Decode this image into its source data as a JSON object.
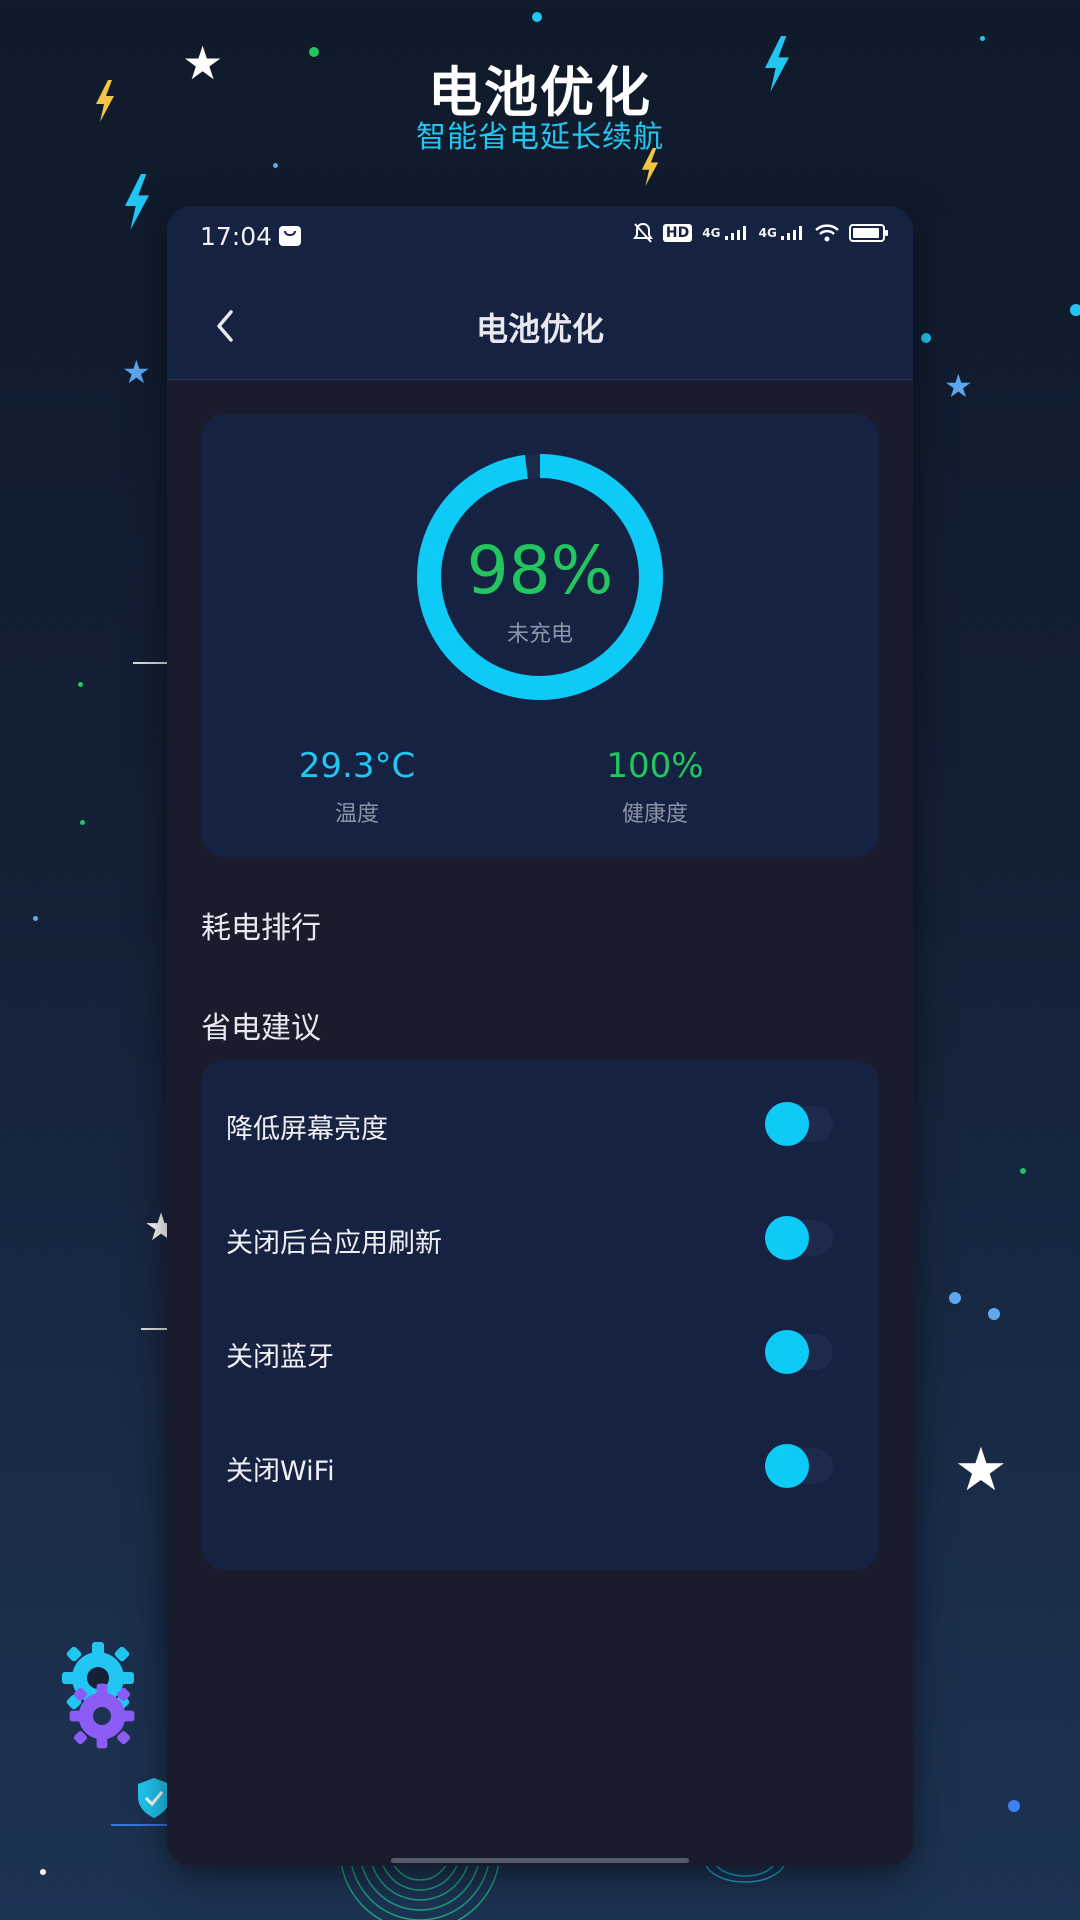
{
  "poster": {
    "title": "电池优化",
    "subtitle": "智能省电延长续航"
  },
  "status_bar": {
    "time": "17:04",
    "icons": [
      "message-icon",
      "mute-icon",
      "hd-icon",
      "signal-4g-icon",
      "signal-4g-icon",
      "wifi-icon",
      "battery-icon"
    ],
    "hd_label": "HD",
    "network_labels": [
      "4G",
      "4G"
    ]
  },
  "header": {
    "title": "电池优化",
    "back_icon": "chevron-left-icon"
  },
  "battery": {
    "level_percent": 98,
    "percent_text": "98%",
    "status": "未充电",
    "temperature": {
      "value": "29.3°C",
      "label": "温度"
    },
    "health": {
      "value": "100%",
      "label": "健康度"
    },
    "ring_color": "#0ecaf6",
    "percent_color": "#22c55e"
  },
  "sections": {
    "power_ranking": "耗电排行",
    "suggestions": "省电建议"
  },
  "suggestions": [
    {
      "label": "降低屏幕亮度",
      "enabled": false
    },
    {
      "label": "关闭后台应用刷新",
      "enabled": false
    },
    {
      "label": "关闭蓝牙",
      "enabled": false
    },
    {
      "label": "关闭WiFi",
      "enabled": false
    }
  ],
  "colors": {
    "accent": "#0ecaf6",
    "green": "#22c55e",
    "card_bg": "#162241",
    "page_bg": "#1a1c2e"
  }
}
